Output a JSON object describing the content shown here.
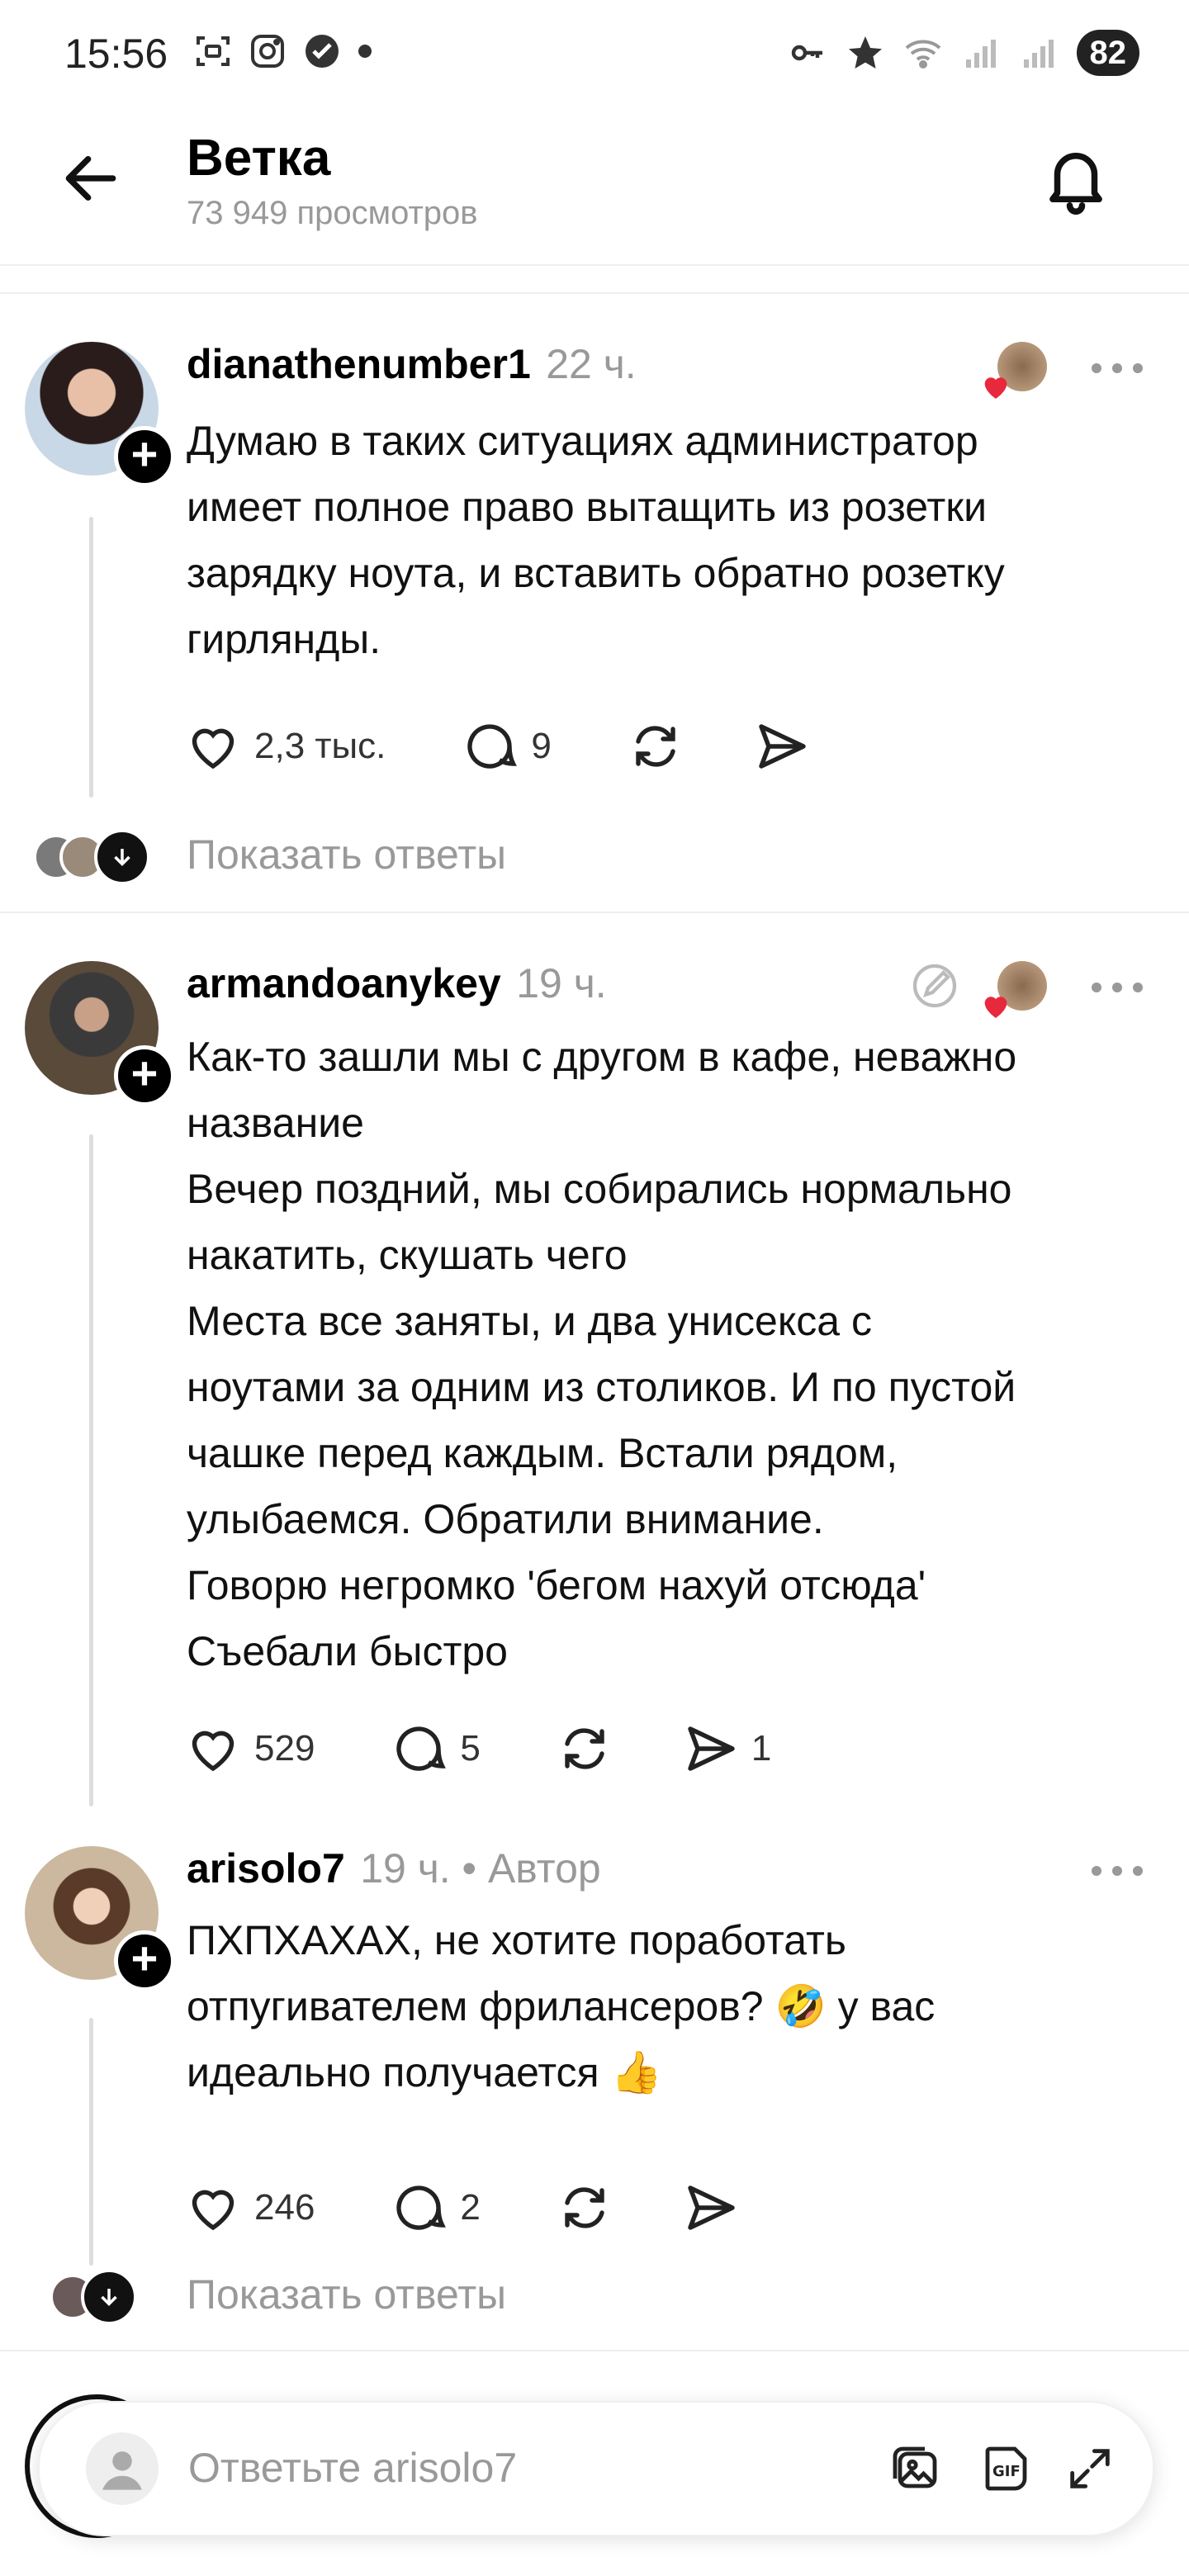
{
  "status_bar": {
    "time": "15:56",
    "battery": "82",
    "icons": [
      "screenshot-icon",
      "instagram-icon",
      "check-icon",
      "dot-icon",
      "vpn-key-icon",
      "star-icon",
      "wifi-icon",
      "signal-icon",
      "signal-icon-2"
    ]
  },
  "header": {
    "title": "Ветка",
    "views": "73 949 просмотров"
  },
  "posts": [
    {
      "username": "dianathenumber1",
      "time": "22 ч.",
      "text_lines": [
        "Думаю в таких ситуациях администратор",
        "имеет полное право вытащить из розетки",
        "зарядку ноута, и вставить обратно розетку",
        "гирлянды."
      ],
      "likes": "2,3 тыс.",
      "comments": "9",
      "show_replies": "Показать ответы"
    },
    {
      "username": "armandoanykey",
      "time": "19 ч.",
      "text_lines": [
        "Как-то зашли мы с другом в кафе, неважно",
        "название",
        "Вечер поздний, мы собирались нормально",
        "накатить, скушать чего",
        "Места все заняты, и два унисекса с",
        "ноутами за одним из столиков. И по пустой",
        "чашке перед каждым. Встали рядом,",
        "улыбаемся. Обратили внимание.",
        "Говорю негромко 'бегом нахуй отсюда'",
        "Съебали быстро"
      ],
      "likes": "529",
      "comments": "5",
      "shares": "1"
    },
    {
      "username": "arisolo7",
      "time": "19 ч. • Автор",
      "text_lines": [
        "ПХПХАХАХ, не хотите поработать",
        "отпугивателем фрилансеров? 🤣 у вас",
        "идеально получается 👍"
      ],
      "likes": "246",
      "comments": "2",
      "show_replies": "Показать ответы"
    }
  ],
  "reply_bar": {
    "placeholder": "Ответьте arisolo7"
  },
  "colors": {
    "heart_red": "#e8283c",
    "muted": "#999999"
  }
}
